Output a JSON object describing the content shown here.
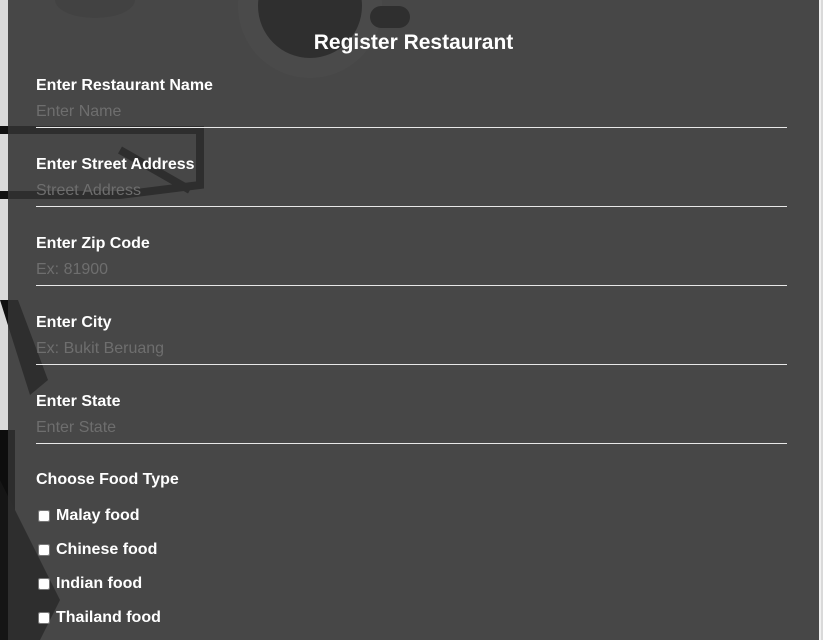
{
  "form": {
    "title": "Register Restaurant",
    "fields": [
      {
        "label": "Enter Restaurant Name",
        "placeholder": "Enter Name",
        "value": ""
      },
      {
        "label": "Enter Street Address",
        "placeholder": "Street Address",
        "value": ""
      },
      {
        "label": "Enter Zip Code",
        "placeholder": "Ex: 81900",
        "value": ""
      },
      {
        "label": "Enter City",
        "placeholder": "Ex: Bukit Beruang",
        "value": ""
      },
      {
        "label": "Enter State",
        "placeholder": "Enter State",
        "value": ""
      }
    ],
    "food_type": {
      "label": "Choose Food Type",
      "options": [
        {
          "label": "Malay food",
          "checked": false
        },
        {
          "label": "Chinese food",
          "checked": false
        },
        {
          "label": "Indian food",
          "checked": false
        },
        {
          "label": "Thailand food",
          "checked": false
        }
      ]
    }
  },
  "colors": {
    "overlay": "#323232",
    "text": "#ffffff",
    "placeholder": "#6e6e6e",
    "underline": "#e8e8e8"
  }
}
